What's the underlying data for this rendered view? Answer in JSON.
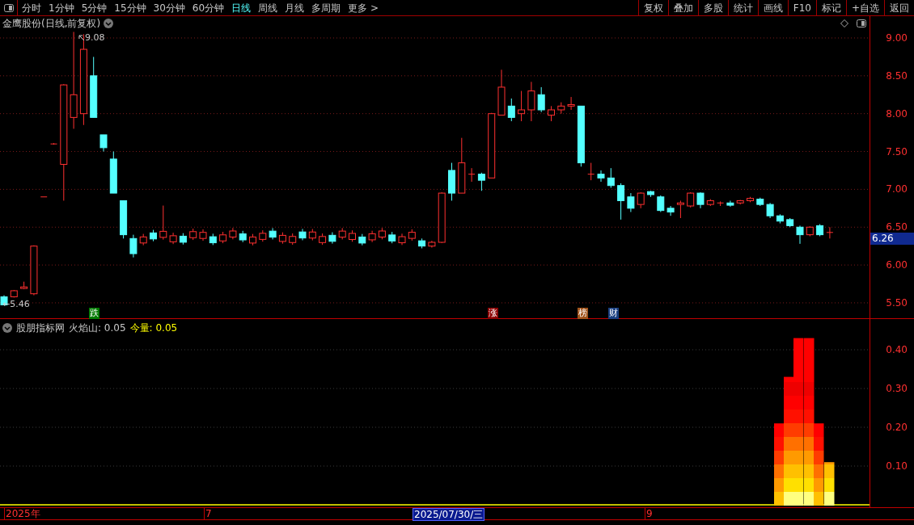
{
  "toolbar": {
    "periods": [
      {
        "label": "分时",
        "selected": false
      },
      {
        "label": "1分钟",
        "selected": false
      },
      {
        "label": "5分钟",
        "selected": false
      },
      {
        "label": "15分钟",
        "selected": false
      },
      {
        "label": "30分钟",
        "selected": false
      },
      {
        "label": "60分钟",
        "selected": false
      },
      {
        "label": "日线",
        "selected": true
      },
      {
        "label": "周线",
        "selected": false
      },
      {
        "label": "月线",
        "selected": false
      },
      {
        "label": "多周期",
        "selected": false
      },
      {
        "label": "更多 >",
        "selected": false
      }
    ],
    "actions": [
      "复权",
      "叠加",
      "多股",
      "统计",
      "画线",
      "F10",
      "标记",
      "+自选",
      "返回"
    ]
  },
  "chart": {
    "title": "金鹰股份(日线,前复权)",
    "high_label": "9.08",
    "low_label": "←5.46",
    "current_price": "6.26",
    "price_ticks": [
      "9.00",
      "8.50",
      "8.00",
      "7.50",
      "7.00",
      "6.50",
      "6.00",
      "5.50"
    ],
    "event_markers": [
      {
        "label": "跌",
        "color": "#007a00"
      },
      {
        "label": "涨",
        "color": "#8b0000"
      },
      {
        "label": "榜",
        "color": "#a0521a"
      },
      {
        "label": "财",
        "color": "#1a3f80"
      }
    ]
  },
  "indicator": {
    "legend": [
      {
        "text": "股朋指标网",
        "kind": "plain"
      },
      {
        "text": "火焰山: 0.05",
        "kind": "plain"
      },
      {
        "text": "今量: 0.05",
        "kind": "volume"
      }
    ],
    "ticks": [
      "0.40",
      "0.30",
      "0.20",
      "0.10"
    ]
  },
  "date_axis": [
    {
      "label": "2025年",
      "selected": false
    },
    {
      "label": "7",
      "selected": false
    },
    {
      "label": "2025/07/30/三",
      "selected": true
    },
    {
      "label": "9",
      "selected": false
    }
  ]
}
